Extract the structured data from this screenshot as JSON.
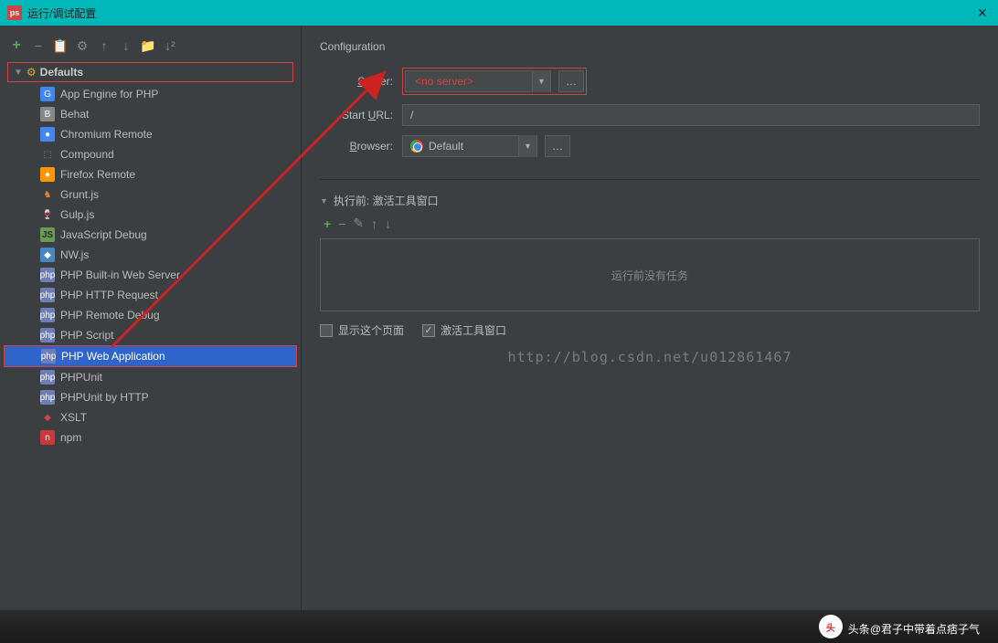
{
  "titlebar": {
    "title": "运行/调试配置"
  },
  "tree": {
    "root": "Defaults",
    "items": [
      {
        "label": "App Engine for PHP",
        "iconClass": "icon-app",
        "iconText": "G"
      },
      {
        "label": "Behat",
        "iconClass": "icon-behat",
        "iconText": "B"
      },
      {
        "label": "Chromium Remote",
        "iconClass": "icon-chromium",
        "iconText": "●"
      },
      {
        "label": "Compound",
        "iconClass": "icon-compound",
        "iconText": "⬚"
      },
      {
        "label": "Firefox Remote",
        "iconClass": "icon-firefox",
        "iconText": "●"
      },
      {
        "label": "Grunt.js",
        "iconClass": "icon-grunt",
        "iconText": "♞"
      },
      {
        "label": "Gulp.js",
        "iconClass": "icon-gulp",
        "iconText": "🍷"
      },
      {
        "label": "JavaScript Debug",
        "iconClass": "icon-js",
        "iconText": "JS"
      },
      {
        "label": "NW.js",
        "iconClass": "icon-nw",
        "iconText": "◆"
      },
      {
        "label": "PHP Built-in Web Server",
        "iconClass": "icon-php",
        "iconText": "php"
      },
      {
        "label": "PHP HTTP Request",
        "iconClass": "icon-php",
        "iconText": "php"
      },
      {
        "label": "PHP Remote Debug",
        "iconClass": "icon-php",
        "iconText": "php"
      },
      {
        "label": "PHP Script",
        "iconClass": "icon-php",
        "iconText": "php"
      },
      {
        "label": "PHP Web Application",
        "iconClass": "icon-php",
        "iconText": "php",
        "selected": true
      },
      {
        "label": "PHPUnit",
        "iconClass": "icon-php",
        "iconText": "php"
      },
      {
        "label": "PHPUnit by HTTP",
        "iconClass": "icon-php",
        "iconText": "php"
      },
      {
        "label": "XSLT",
        "iconClass": "icon-xslt",
        "iconText": "◆"
      },
      {
        "label": "npm",
        "iconClass": "icon-npm",
        "iconText": "n"
      }
    ]
  },
  "config": {
    "title": "Configuration",
    "serverLabel": "Server:",
    "serverValue": "<no server>",
    "startUrlLabel": "Start URL:",
    "startUrlValue": "/",
    "browserLabel": "Browser:",
    "browserValue": "Default",
    "beforeRun": "执行前: 激活工具窗口",
    "emptyTasks": "运行前没有任务",
    "checkboxes": {
      "showPage": "显示这个页面",
      "activate": "激活工具窗口"
    }
  },
  "watermark": "http://blog.csdn.net/u012861467",
  "footer": {
    "toutiao": "头条",
    "author": "@君子中带着点痞子气"
  }
}
